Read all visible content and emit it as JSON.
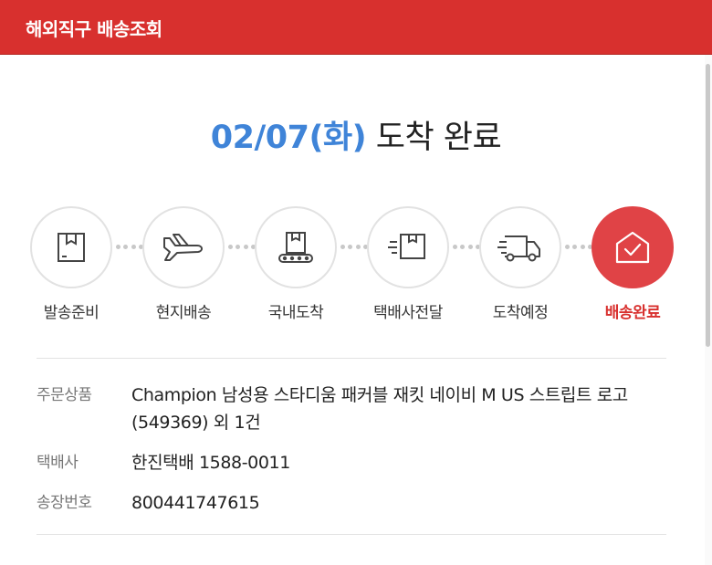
{
  "header": {
    "title": "해외직구 배송조회",
    "color": "#d8302e"
  },
  "status": {
    "date": "02/07(화)",
    "text": " 도착 완료",
    "date_color": "#3f84d8"
  },
  "steps": [
    {
      "label": "발송준비",
      "icon": "package-box-icon",
      "active": false
    },
    {
      "label": "현지배송",
      "icon": "airplane-icon",
      "active": false
    },
    {
      "label": "국내도착",
      "icon": "conveyor-box-icon",
      "active": false
    },
    {
      "label": "택배사전달",
      "icon": "moving-box-icon",
      "active": false
    },
    {
      "label": "도착예정",
      "icon": "delivery-truck-icon",
      "active": false
    },
    {
      "label": "배송완료",
      "icon": "house-check-icon",
      "active": true
    }
  ],
  "info": {
    "product_label": "주문상품",
    "product_value": "Champion 남성용 스타디움 패커블 재킷 네이비 M US 스트립트 로고 (549369) 외 1건",
    "courier_label": "택배사",
    "courier_value": "한진택배 1588-0011",
    "tracking_label": "송장번호",
    "tracking_value": "800441747615"
  },
  "colors": {
    "active_step": "#e04346",
    "inactive_border": "#e2e2e2"
  }
}
